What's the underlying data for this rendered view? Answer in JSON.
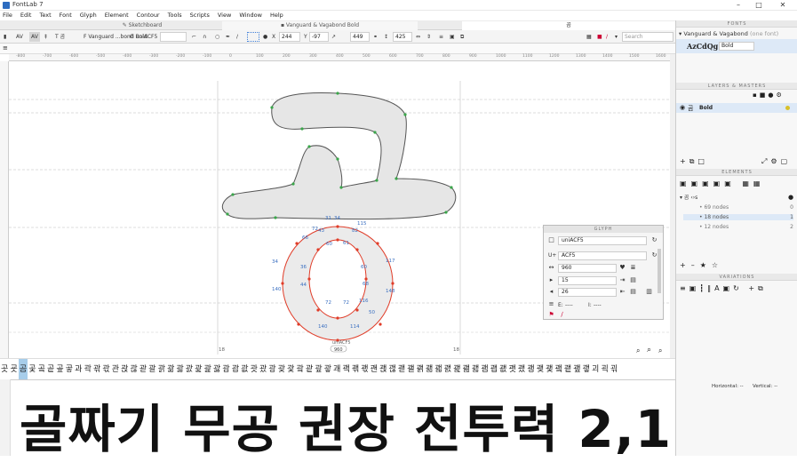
{
  "window": {
    "app_title": "FontLab 7",
    "min_icon": "minimize-icon",
    "max_icon": "maximize-icon",
    "close_icon": "close-icon"
  },
  "menu": [
    "File",
    "Edit",
    "Text",
    "Font",
    "Glyph",
    "Element",
    "Contour",
    "Tools",
    "Scripts",
    "View",
    "Window",
    "Help"
  ],
  "tabs": {
    "sketchboard": "Sketchboard",
    "font": "Vanguard & Vagabond Bold",
    "glyph": "곰"
  },
  "toolbar": {
    "font_name": "Vanguard ...bond Bold",
    "glyph_name": "uniACF5",
    "x_label": "X",
    "x_value": "244",
    "y_label": "Y",
    "y_value": "-97",
    "w_value": "449",
    "h_value": "425",
    "search_placeholder": "Search"
  },
  "ruler_ticks": [
    "-800",
    "-700",
    "-600",
    "-500",
    "-400",
    "-300",
    "-200",
    "-100",
    "0",
    "100",
    "200",
    "300",
    "400",
    "500",
    "600",
    "700",
    "800",
    "900",
    "1000",
    "1100",
    "1200",
    "1300",
    "1400",
    "1500",
    "1600",
    "1700"
  ],
  "canvas": {
    "left_margin": "18",
    "right_margin": "18",
    "glyph_label": "uniACF5",
    "advance_width": "960",
    "node_labels": [
      "31",
      "34",
      "115",
      "66",
      "72",
      "61",
      "60",
      "36",
      "44",
      "60",
      "72",
      "140",
      "148",
      "117",
      "116",
      "72",
      "68",
      "34",
      "140",
      "114",
      "82",
      "43",
      "50"
    ]
  },
  "glyph_strip": [
    "곳",
    "굣",
    "곰",
    "곷",
    "곸",
    "곹",
    "곺",
    "곻",
    "과",
    "곽",
    "곾",
    "곿",
    "관",
    "괁",
    "괂",
    "괃",
    "괄",
    "괅",
    "괆",
    "괇",
    "괈",
    "괉",
    "괊",
    "괋",
    "괌",
    "괍",
    "괎",
    "괏",
    "괐",
    "광",
    "괒",
    "괓",
    "괔",
    "괕",
    "괖",
    "괗",
    "괘",
    "괙",
    "괚",
    "괛",
    "괜",
    "괝",
    "괞",
    "괟",
    "괠",
    "괡",
    "괢",
    "괣",
    "괤",
    "괥",
    "괦",
    "괧",
    "괨",
    "괩",
    "괪",
    "괫",
    "괬",
    "괭",
    "괮",
    "괯",
    "괰",
    "괱",
    "괲",
    "괳",
    "괴",
    "괵",
    "괶"
  ],
  "glyph_strip_selected": 2,
  "preview_text": "골짜기 무공 권장 전투력 2,127",
  "right_panel": {
    "fonts_title": "FONTS",
    "font_family": "Vanguard & Vagabond",
    "font_count": "(one font)",
    "sample": "AzCdQg",
    "style": "Bold",
    "layers_title": "LAYERS & MASTERS",
    "layer_name": "Bold",
    "layer_glyph": "곰",
    "elements_title": "ELEMENTS",
    "element_root": "곰",
    "elements": [
      {
        "name": "69 nodes",
        "count": "0"
      },
      {
        "name": "18 nodes",
        "count": "1"
      },
      {
        "name": "12 nodes",
        "count": "2"
      }
    ],
    "variations_title": "VARIATIONS",
    "horizontal": "Horizontal: --",
    "vertical": "Vertical: --"
  },
  "glyph_panel": {
    "title": "GLYPH",
    "name": "uniACF5",
    "unicode_label": "U+",
    "unicode": "ACF5",
    "advance": "960",
    "lsb": "15",
    "rsb": "26",
    "field_e": "----",
    "field_i": "----"
  },
  "colors": {
    "accent": "#3d7ed8",
    "contour_red": "#e03c28",
    "node_green": "#3aa64a",
    "selected_glyph": "#a7cdea"
  }
}
